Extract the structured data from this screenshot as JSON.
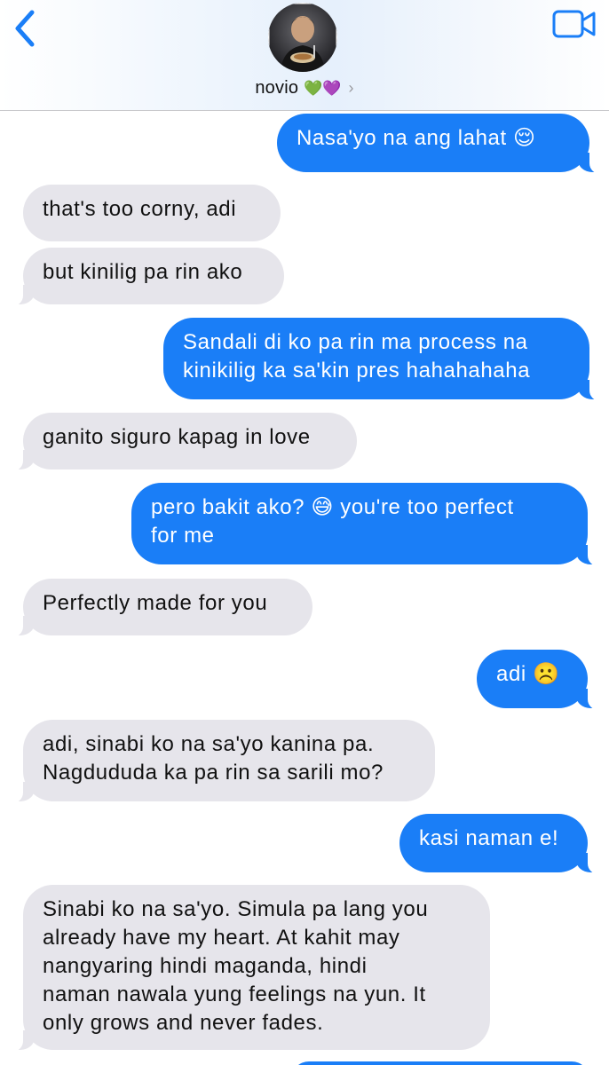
{
  "header": {
    "contact_name": "novio",
    "contact_hearts": "💚💜",
    "chevron": "›",
    "back_icon": "chevron-left-icon",
    "video_icon": "video-camera-icon"
  },
  "colors": {
    "sent_bubble": "#1a7ef7",
    "received_bubble": "#e6e5eb",
    "accent": "#1a7ef7"
  },
  "messages": [
    {
      "from": "me",
      "text": "Nasa'yo na ang lahat 😌"
    },
    {
      "from": "them",
      "text": "that's too corny, adi"
    },
    {
      "from": "them",
      "text": "but kinilig pa rin ako"
    },
    {
      "from": "me",
      "text": "Sandali di ko pa rin ma process na\nkinikilig ka sa'kin pres hahahahaha"
    },
    {
      "from": "them",
      "text": "ganito siguro kapag in love"
    },
    {
      "from": "me",
      "text": "pero bakit ako? 😅 you're too perfect\nfor me"
    },
    {
      "from": "them",
      "text": "Perfectly made for you"
    },
    {
      "from": "me",
      "text": "adi ☹️"
    },
    {
      "from": "them",
      "text": "adi, sinabi ko na sa'yo kanina pa.\nNagdududa ka pa rin sa sarili mo?"
    },
    {
      "from": "me",
      "text": "kasi naman e!"
    },
    {
      "from": "them",
      "text": "Sinabi ko na sa'yo. Simula pa lang you\nalready have my heart. At kahit may\nnangyaring hindi maganda, hindi\nnaman nawala yung feelings na yun. It\nonly grows and never fades."
    }
  ]
}
